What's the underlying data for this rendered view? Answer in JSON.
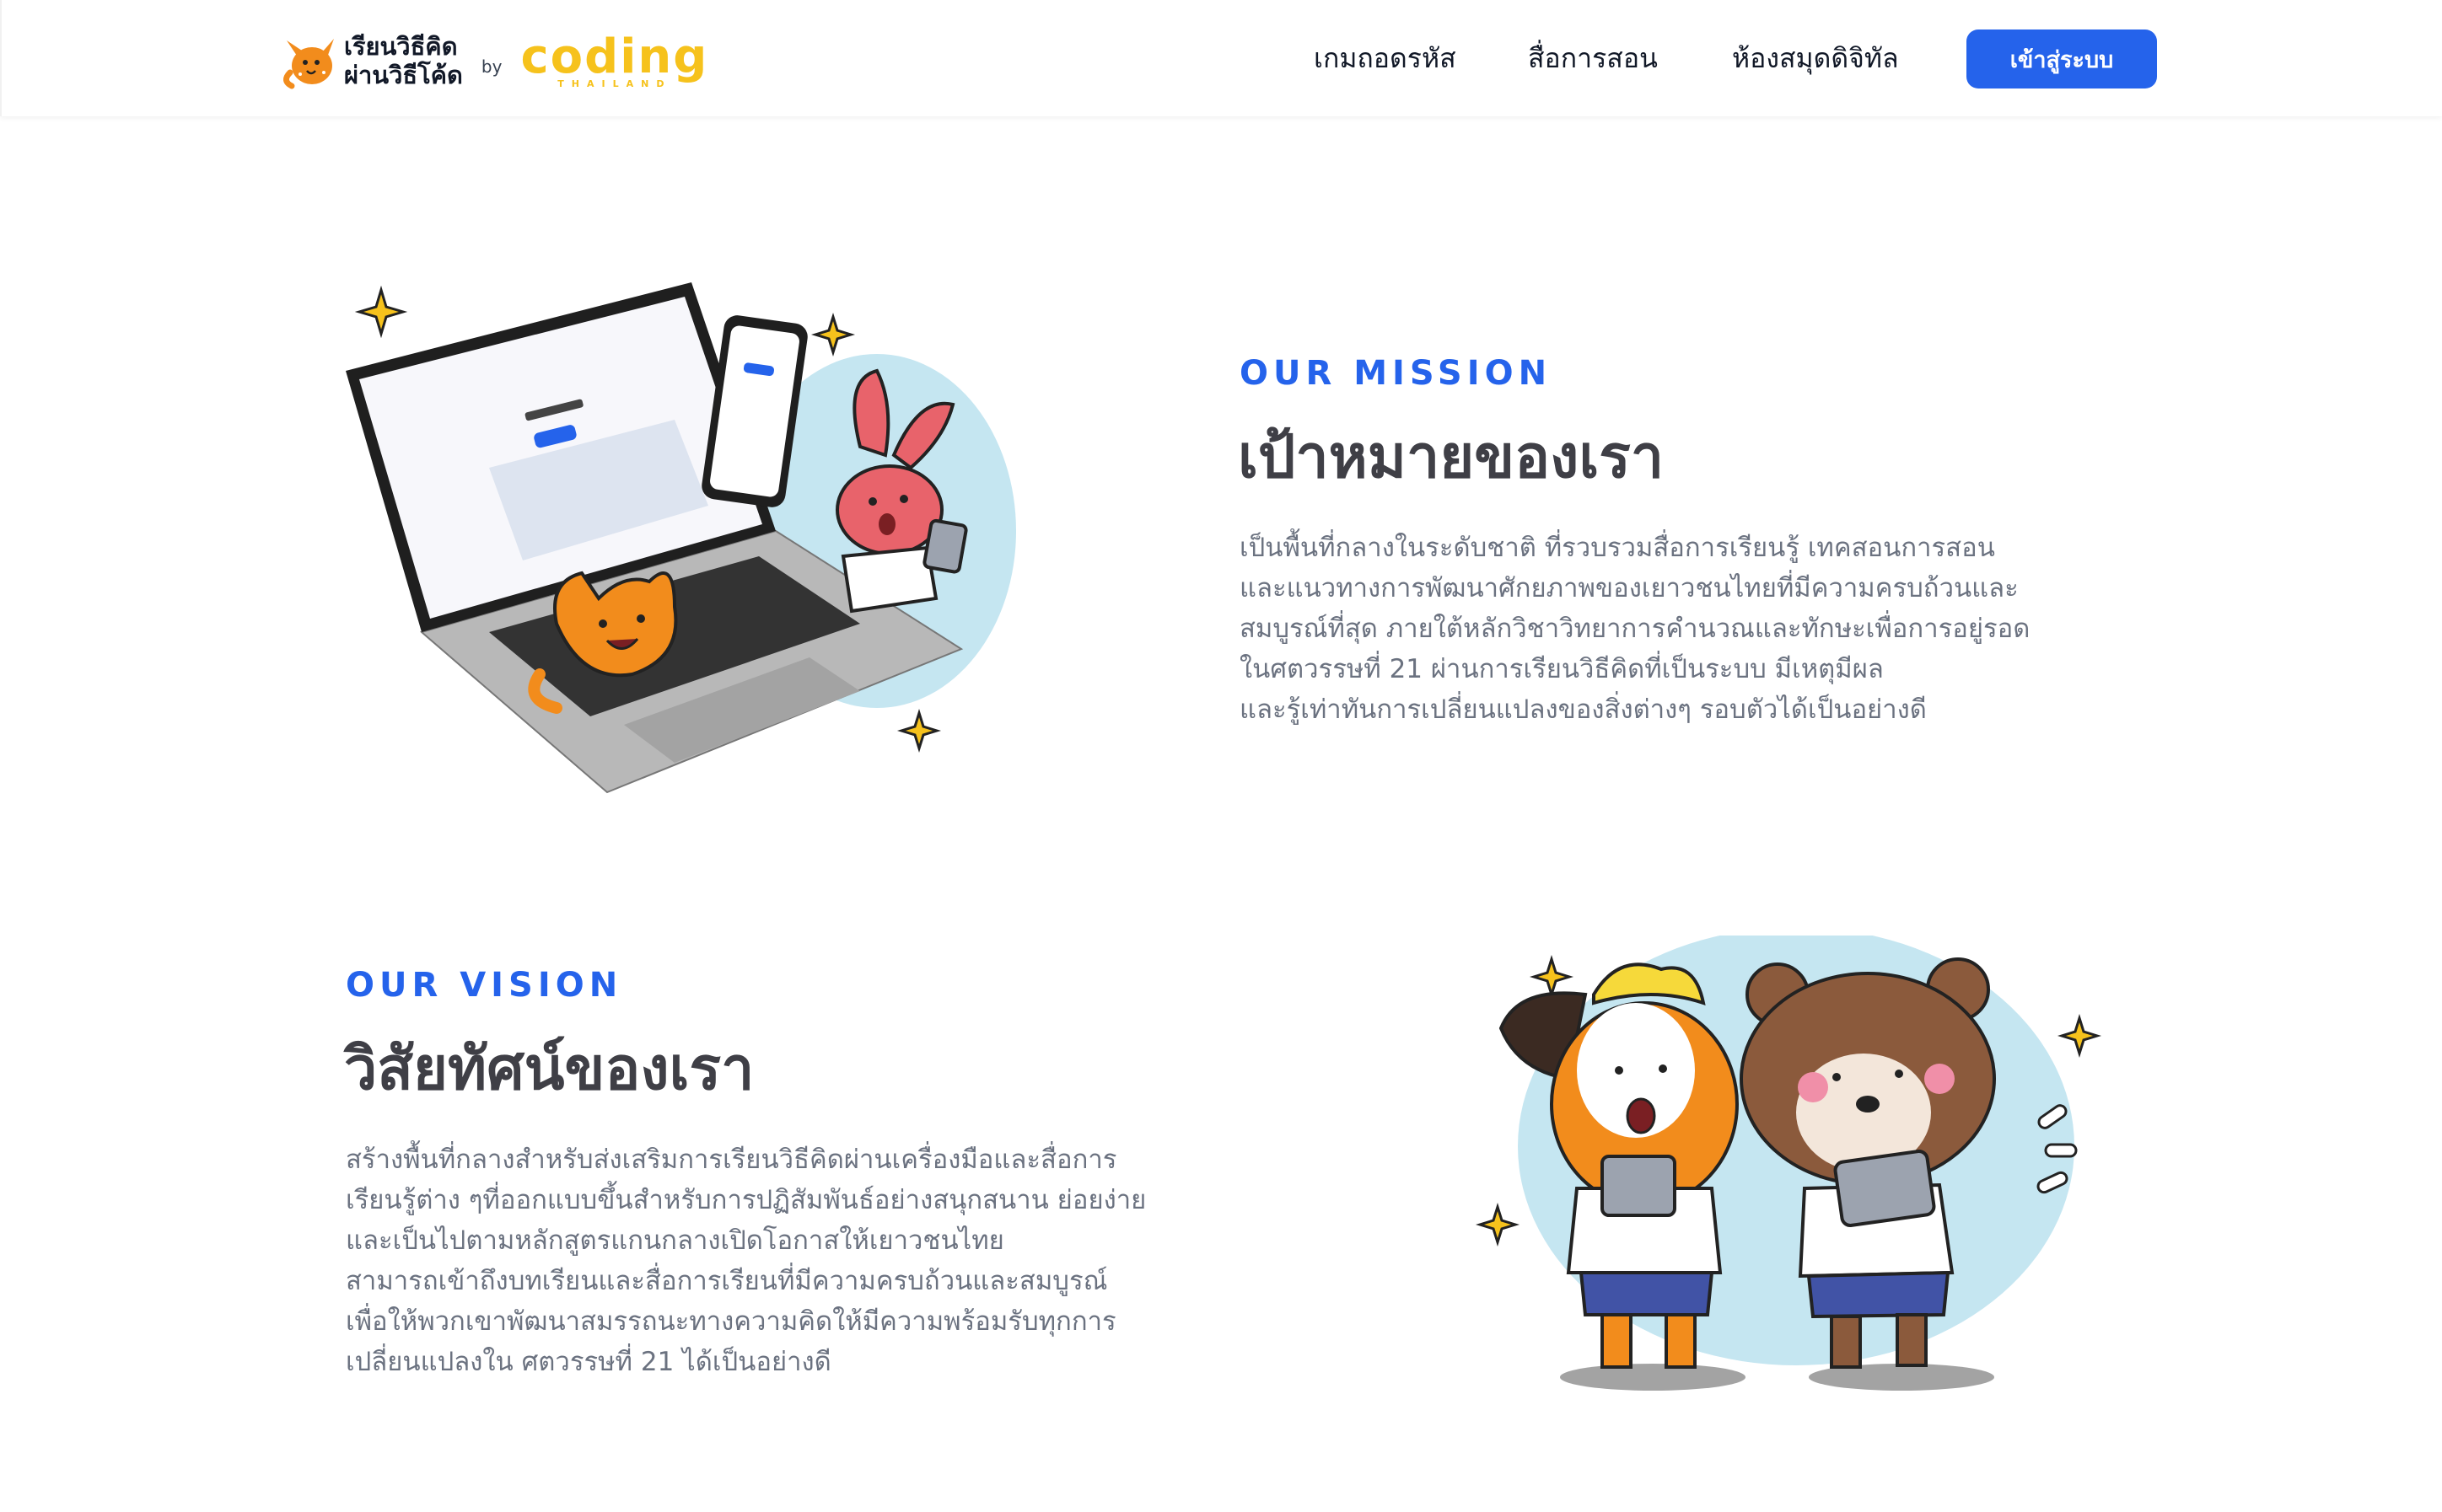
{
  "header": {
    "logo": {
      "thai_line1": "เรียนวิธีคิด",
      "thai_line2": "ผ่านวิธีโค้ด",
      "by": "by",
      "coding_word": "coding",
      "coding_sub": "THAILAND"
    },
    "nav": [
      {
        "label": "เกมถอดรหัส"
      },
      {
        "label": "สื่อการสอน"
      },
      {
        "label": "ห้องสมุดดิจิทัล"
      }
    ],
    "login_label": "เข้าสู่ระบบ"
  },
  "mission": {
    "eyebrow": "OUR MISSION",
    "title": "เป้าหมายของเรา",
    "lines": [
      "เป็นพื้นที่กลางในระดับชาติ ที่รวบรวมสื่อการเรียนรู้ เทคสอนการสอน",
      "และแนวทางการพัฒนาศักยภาพของเยาวชนไทยที่มีความครบถ้วนและ",
      "สมบูรณ์ที่สุด ภายใต้หลักวิชาวิทยาการคำนวณและทักษะเพื่อการอยู่รอด",
      "ในศตวรรษที่ 21 ผ่านการเรียนวิธีคิดที่เป็นระบบ มีเหตุมีผล",
      "และรู้เท่าทันการเปลี่ยนแปลงของสิ่งต่างๆ รอบตัวได้เป็นอย่างดี"
    ]
  },
  "vision": {
    "eyebrow": "OUR VISION",
    "title": "วิสัยทัศน์ของเรา",
    "lines": [
      "สร้างพื้นที่กลางสำหรับส่งเสริมการเรียนวิธีคิดผ่านเครื่องมือและสื่อการ",
      "เรียนรู้ต่าง ๆที่ออกแบบขึ้นสำหรับการปฏิสัมพันธ์อย่างสนุกสนาน ย่อยง่าย",
      "และเป็นไปตามหลักสูตรแกนกลางเปิดโอกาสให้เยาวชนไทย",
      "สามารถเข้าถึงบทเรียนและสื่อการเรียนที่มีความครบถ้วนและสมบูรณ์",
      "เพื่อให้พวกเขาพัฒนาสมรรถนะทางความคิดให้มีความพร้อมรับทุกการ",
      "เปลี่ยนแปลงใน ศตวรรษที่ 21 ได้เป็นอย่างดี"
    ]
  },
  "colors": {
    "accent": "#2563eb",
    "coding_yellow": "#f6c21c",
    "blob": "#c5e6f1"
  }
}
